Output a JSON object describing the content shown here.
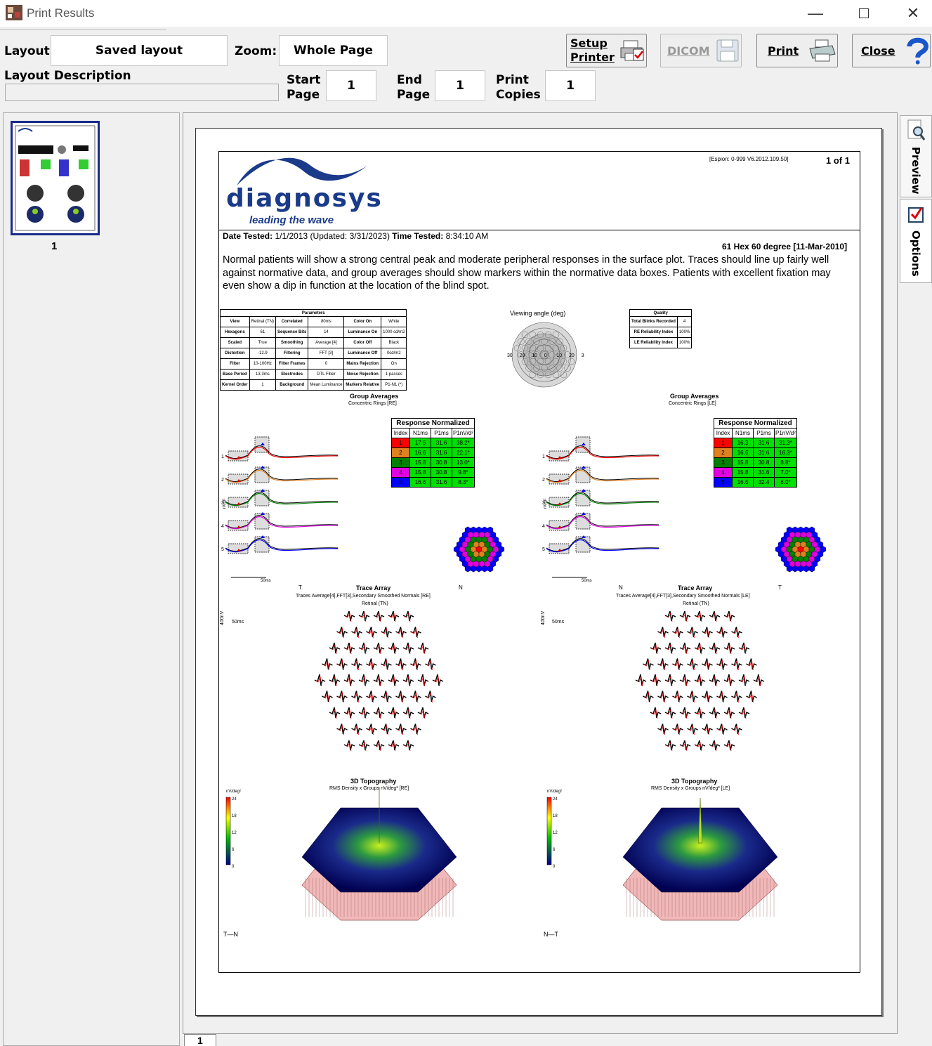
{
  "window": {
    "title": "Print Results"
  },
  "toolbar": {
    "layout_label": "Layout:",
    "layout_value": "Saved layout",
    "zoom_label": "Zoom:",
    "zoom_value": "Whole Page",
    "layout_description_label": "Layout Description",
    "start_page_label": "Start Page",
    "start_page_value": "1",
    "end_page_label": "End Page",
    "end_page_value": "1",
    "print_copies_label": "Print Copies",
    "print_copies_value": "1",
    "setup_printer_label": "Setup Printer",
    "dicom_label": "DICOM",
    "print_label": "Print",
    "close_label": "Close"
  },
  "thumbnails": [
    {
      "label": "1"
    }
  ],
  "side_tabs": [
    "Preview",
    "Options"
  ],
  "bottom_tab": "1",
  "report": {
    "version": "[Espion: 0-999 V6.2012.109.50]",
    "page_count": "1 of 1",
    "logo_name": "diagnosys",
    "logo_tagline": "leading the wave",
    "date_tested_label": "Date Tested:",
    "date_tested": "1/1/2013 (Updated: 3/31/2023)",
    "time_tested_label": "Time Tested:",
    "time_tested": "8:34:10 AM",
    "protocol": "61 Hex 60 degree [11-Mar-2010]",
    "description": "Normal patients will show a strong central peak and moderate peripheral responses in the surface plot. Traces should line up fairly well against normative data, and group averages should show markers within the normative data boxes. Patients with excellent fixation may even show a dip in function at the location of the blind spot.",
    "parameters_title": "Parameters",
    "parameters": [
      [
        "View",
        "Retinal (TN)",
        "Correlated",
        "80ms",
        "Color On",
        "White"
      ],
      [
        "Hexagons",
        "61",
        "Sequence Bits",
        "14",
        "Luminance On",
        "1000 cd/m2"
      ],
      [
        "Scaled",
        "True",
        "Smoothing",
        "Average [4]",
        "Color Off",
        "Black"
      ],
      [
        "Distortion",
        "-12.9",
        "Filtering",
        "FFT [3]",
        "Luminance Off",
        "0cd/m2"
      ],
      [
        "Filter",
        "10-100Hz",
        "Filter Frames",
        "0",
        "Mains Rejection",
        "On"
      ],
      [
        "Base Period",
        "13.3ms",
        "Electrodes",
        "DTL Fiber",
        "Noise Rejection",
        "1 passes"
      ],
      [
        "Kernel Order",
        "1",
        "Background",
        "Mean Luminance",
        "Markers Relative",
        "P1-N1 (*)"
      ]
    ],
    "viewing_angle_label": "Viewing angle (deg)",
    "viewing_angle_ticks": [
      "30",
      "20",
      "10",
      "0",
      "10",
      "20",
      "30"
    ],
    "quality_title": "Quality",
    "quality": [
      [
        "Total Blinks Recorded",
        "4"
      ],
      [
        "RE Reliability Index",
        "100%"
      ],
      [
        "LE Reliability Index",
        "100%"
      ]
    ],
    "group_avg_title": "Group Averages",
    "group_avg_re_sub": "Concentric Rings [RE]",
    "group_avg_le_sub": "Concentric Rings [LE]",
    "response_title": "Response Normalized",
    "response_headers": [
      "Index",
      "N1ms",
      "P1ms",
      "P1nV/d²"
    ],
    "response_re": [
      [
        "1",
        "17.5",
        "31.6",
        "38.2*"
      ],
      [
        "2",
        "16.6",
        "31.6",
        "22.1*"
      ],
      [
        "3",
        "15.8",
        "30.8",
        "13.0*"
      ],
      [
        "4",
        "15.8",
        "30.8",
        "9.8*"
      ],
      [
        "5",
        "16.6",
        "31.6",
        "8.3*"
      ]
    ],
    "response_le": [
      [
        "1",
        "16.3",
        "31.6",
        "31.3*"
      ],
      [
        "2",
        "16.6",
        "31.6",
        "16.3*"
      ],
      [
        "3",
        "15.8",
        "30.8",
        "8.8*"
      ],
      [
        "4",
        "15.8",
        "31.6",
        "7.0*"
      ],
      [
        "5",
        "16.6",
        "32.4",
        "6.0*"
      ]
    ],
    "ring_labels": [
      "1",
      "2",
      "3",
      "4",
      "5"
    ],
    "ring_colors": [
      "#ff0000",
      "#e08020",
      "#008000",
      "#e000e0",
      "#0000ff"
    ],
    "scale_ms": "50ms",
    "scale_nv": "nV/d²",
    "trace_array_title": "Trace Array",
    "trace_array_re_sub": "Traces Average[4],FFT[3],Secondary Smoothed Normals [RE]",
    "trace_array_le_sub": "Traces Average[4],FFT[3],Secondary Smoothed Normals [LE]",
    "trace_array_view": "Retinal (TN)",
    "trace_scale_nv": "400nV",
    "trace_scale_ms": "50ms",
    "re_left": "T",
    "re_right": "N",
    "le_left": "N",
    "le_right": "T",
    "topo_title": "3D Topography",
    "topo_re_sub": "RMS Density x Groups nV/deg² [RE]",
    "topo_le_sub": "RMS Density x Groups nV/deg² [LE]",
    "colorbar_unit": "nV/deg²",
    "colorbar_ticks": [
      "24",
      "18",
      "12",
      "6",
      "0"
    ],
    "orient_re": "T—N",
    "orient_le": "N—T"
  },
  "colors": {
    "accent": "#1a3a8a",
    "dicom_disabled": "#999999"
  }
}
